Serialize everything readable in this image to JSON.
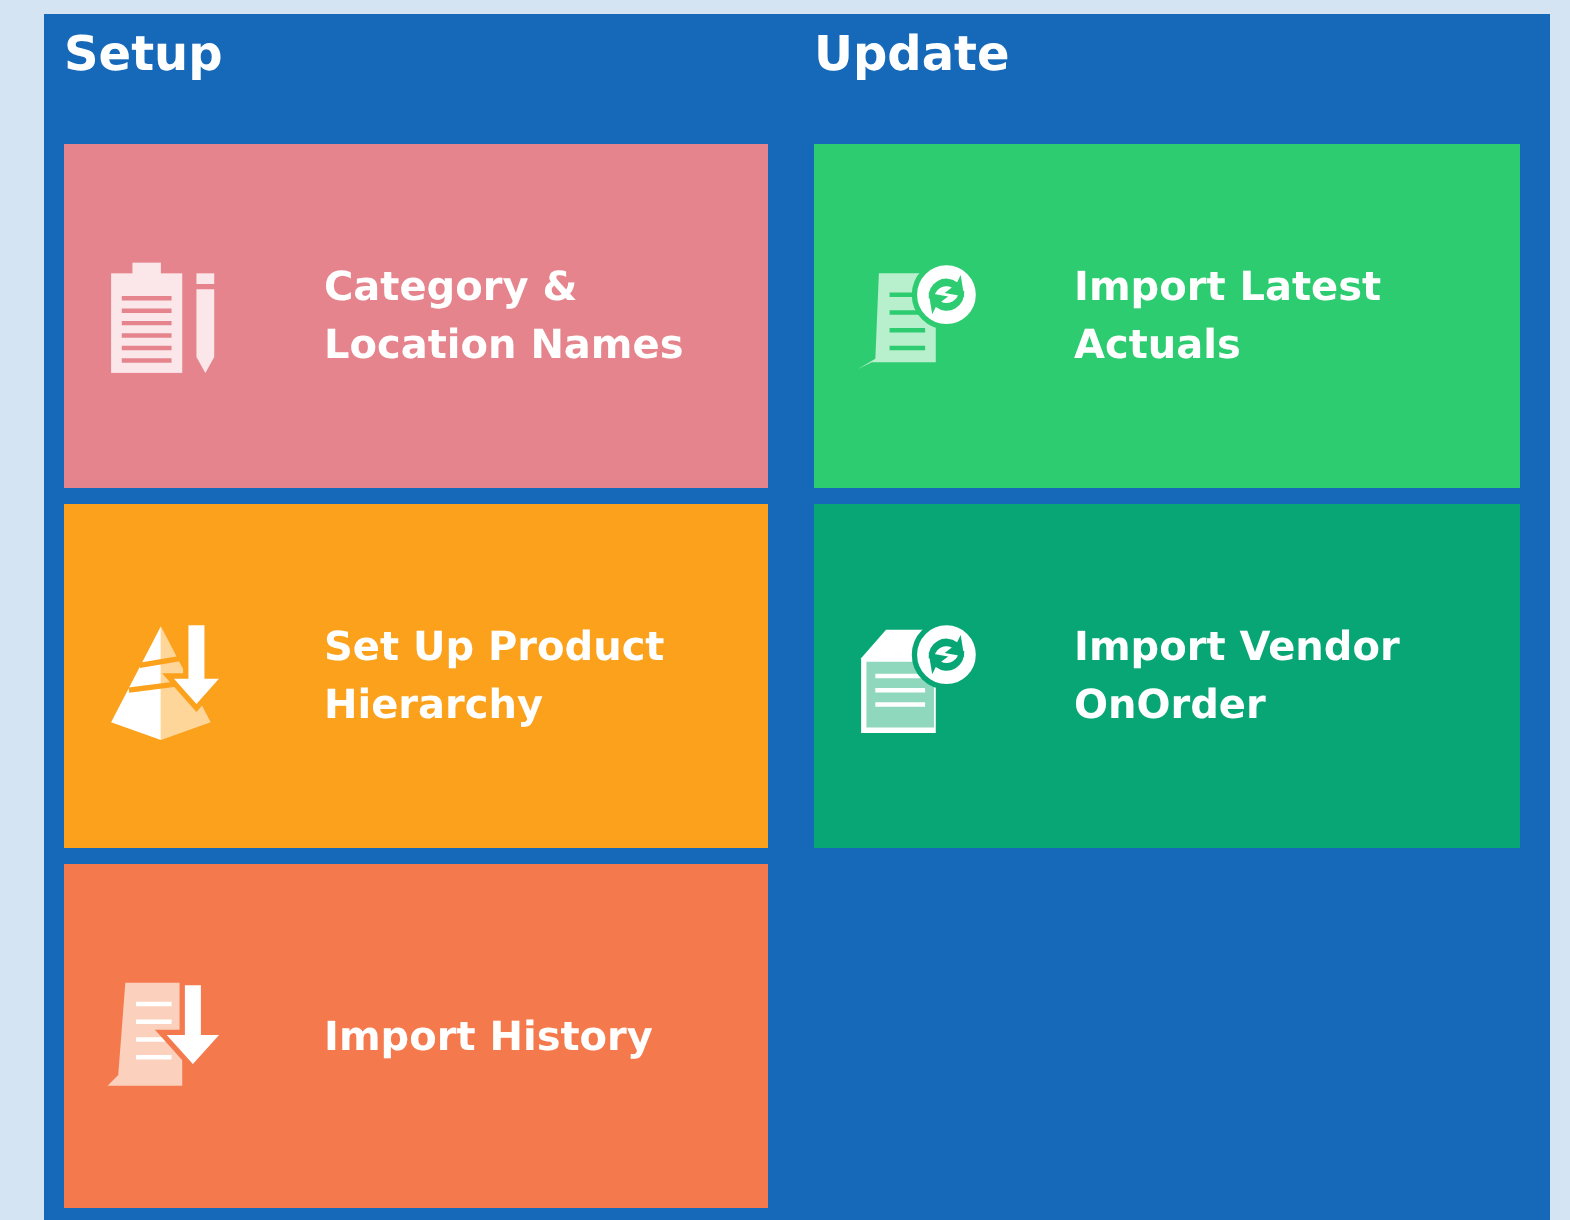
{
  "sections": [
    {
      "title": "Setup",
      "tiles": [
        {
          "label": "Category & Location Names",
          "kind": "clipboard",
          "color": "#e5848d"
        },
        {
          "label": "Set Up Product Hierarchy",
          "kind": "pyramid",
          "color": "#fca11b"
        },
        {
          "label": "Import History",
          "kind": "scroll-down",
          "color": "#f47a4d"
        }
      ]
    },
    {
      "title": "Update",
      "tiles": [
        {
          "label": "Import Latest Actuals",
          "kind": "scroll-sync",
          "color": "#2ecc71"
        },
        {
          "label": "Import Vendor OnOrder",
          "kind": "doc-sync",
          "color": "#08a575"
        }
      ]
    }
  ]
}
